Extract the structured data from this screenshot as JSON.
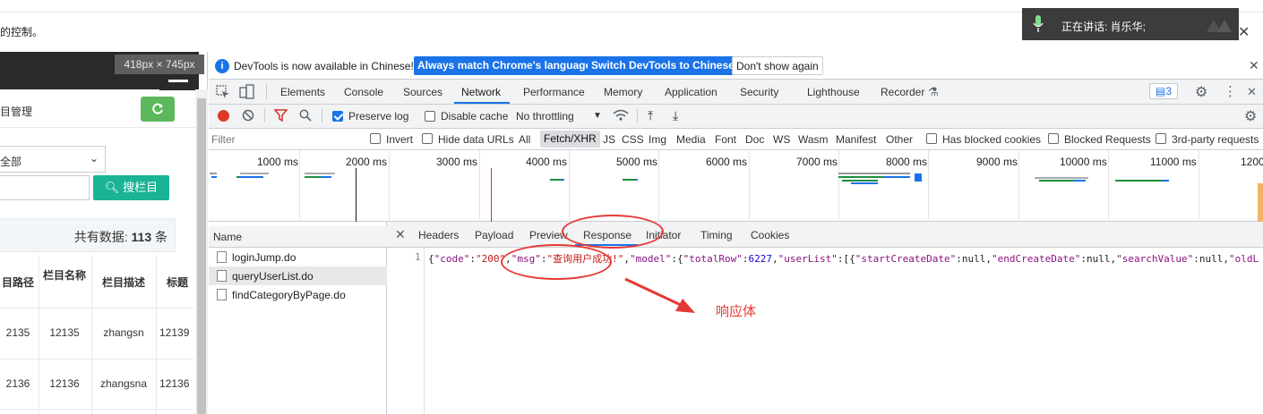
{
  "browser": {
    "top_faint": "",
    "notice": "的控制。",
    "speaking_label": "正在讲话:  肖乐华;",
    "close_glyph": "✕"
  },
  "left_page": {
    "size_badge": "418px × 745px",
    "title": "目管理",
    "status_select": "全部",
    "search_button": "搜栏目",
    "total_prefix": "共有数据:",
    "total_count": "113",
    "total_suffix": "条",
    "table": {
      "headers": [
        "目路径",
        "栏目名称",
        "栏目描述",
        "标题"
      ],
      "rows": [
        [
          "2135",
          "12135",
          "zhangsn",
          "12139"
        ],
        [
          "2136",
          "12136",
          "zhangsna",
          "12136"
        ]
      ]
    }
  },
  "devtools": {
    "infobar": {
      "text": "DevTools is now available in Chinese!",
      "btn_match": "Always match Chrome's language",
      "btn_switch": "Switch DevTools to Chinese",
      "btn_dismiss": "Don't show again"
    },
    "tabs": [
      "Elements",
      "Console",
      "Sources",
      "Network",
      "Performance",
      "Memory",
      "Application",
      "Security",
      "Lighthouse",
      "Recorder"
    ],
    "active_tab": "Network",
    "issues_count": "3",
    "toolbar": {
      "preserve_log": "Preserve log",
      "disable_cache": "Disable cache",
      "throttling": "No throttling"
    },
    "filter": {
      "placeholder": "Filter",
      "invert": "Invert",
      "hide_data_urls": "Hide data URLs",
      "types": [
        "All",
        "Fetch/XHR",
        "JS",
        "CSS",
        "Img",
        "Media",
        "Font",
        "Doc",
        "WS",
        "Wasm",
        "Manifest",
        "Other"
      ],
      "has_blocked": "Has blocked cookies",
      "blocked_requests": "Blocked Requests",
      "third_party": "3rd-party requests"
    },
    "timeline_ticks": [
      "1000 ms",
      "2000 ms",
      "3000 ms",
      "4000 ms",
      "5000 ms",
      "6000 ms",
      "7000 ms",
      "8000 ms",
      "9000 ms",
      "10000 ms",
      "11000 ms",
      "1200"
    ],
    "requests": {
      "header": "Name",
      "items": [
        "loginJump.do",
        "queryUserList.do",
        "findCategoryByPage.do"
      ],
      "selected": "queryUserList.do"
    },
    "detail_tabs": [
      "Headers",
      "Payload",
      "Preview",
      "Response",
      "Initiator",
      "Timing",
      "Cookies"
    ],
    "active_detail_tab": "Response",
    "response": {
      "line_no": "1",
      "code": "200",
      "msg": "查询用户成功!",
      "total_row": "6227",
      "user_list_prefix": "[{"
    }
  },
  "annotation": {
    "label": "响应体",
    "color": "#e53935"
  },
  "colors": {
    "accent": "#1a73e8",
    "refresh_green": "#5cb85c",
    "search_green": "#1ab394"
  }
}
